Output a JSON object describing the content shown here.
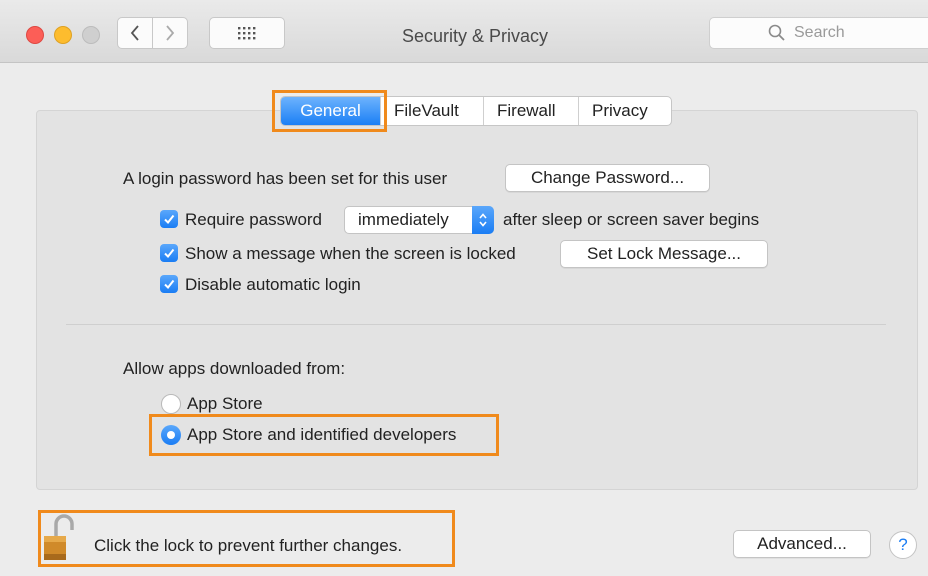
{
  "window": {
    "title": "Security & Privacy"
  },
  "search": {
    "placeholder": "Search"
  },
  "tabs": [
    {
      "label": "General",
      "active": true
    },
    {
      "label": "FileVault",
      "active": false
    },
    {
      "label": "Firewall",
      "active": false
    },
    {
      "label": "Privacy",
      "active": false
    }
  ],
  "general": {
    "login_password_text": "A login password has been set for this user",
    "change_password_label": "Change Password...",
    "require_password": {
      "label": "Require password",
      "checked": true,
      "selected": "immediately",
      "suffix": "after sleep or screen saver begins"
    },
    "show_message": {
      "label": "Show a message when the screen is locked",
      "checked": true,
      "button_label": "Set Lock Message..."
    },
    "disable_auto_login": {
      "label": "Disable automatic login",
      "checked": true
    },
    "allow_apps_heading": "Allow apps downloaded from:",
    "options": [
      {
        "label": "App Store",
        "selected": false
      },
      {
        "label": "App Store and identified developers",
        "selected": true
      }
    ]
  },
  "footer": {
    "lock_text": "Click the lock to prevent further changes.",
    "advanced_label": "Advanced...",
    "help_label": "?"
  },
  "colors": {
    "accent": "#1a7df4",
    "highlight": "#f08a1c"
  }
}
